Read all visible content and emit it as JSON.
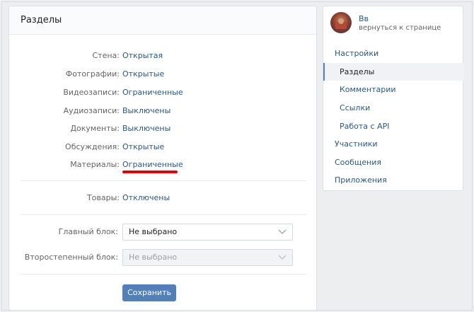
{
  "header": {
    "title": "Разделы"
  },
  "sections": [
    {
      "label": "Стена:",
      "value": "Открытая"
    },
    {
      "label": "Фотографии:",
      "value": "Открытые"
    },
    {
      "label": "Видеозаписи:",
      "value": "Ограниченные"
    },
    {
      "label": "Аудиозаписи:",
      "value": "Выключены"
    },
    {
      "label": "Документы:",
      "value": "Выключены"
    },
    {
      "label": "Обсуждения:",
      "value": "Открытые"
    },
    {
      "label": "Материалы:",
      "value": "Ограниченные"
    }
  ],
  "goods": {
    "label": "Товары:",
    "value": "Отключены"
  },
  "main_block": {
    "label": "Главный блок:",
    "value": "Не выбрано"
  },
  "secondary_block": {
    "label": "Второстепенный блок:",
    "value": "Не выбрано"
  },
  "save_label": "Сохранить",
  "profile": {
    "name": "Вв",
    "back": "вернуться к странице"
  },
  "menu": [
    {
      "label": "Настройки"
    },
    {
      "label": "Разделы"
    },
    {
      "label": "Комментарии"
    },
    {
      "label": "Ссылки"
    },
    {
      "label": "Работа с API"
    },
    {
      "label": "Участники"
    },
    {
      "label": "Сообщения"
    },
    {
      "label": "Приложения"
    }
  ],
  "colors": {
    "accent": "#5181b8",
    "link": "#2a5885",
    "highlight": "#e00000"
  }
}
